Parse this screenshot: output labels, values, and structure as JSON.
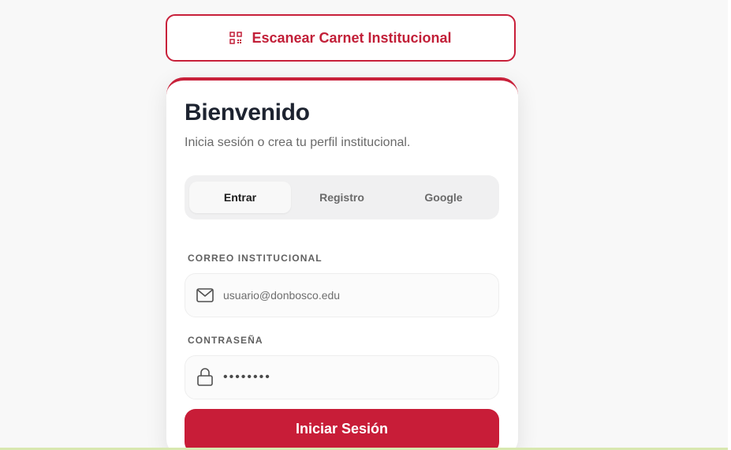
{
  "scan_button": {
    "label": "Escanear Carnet Institucional",
    "icon": "qr-code-icon"
  },
  "card": {
    "title": "Bienvenido",
    "subtitle": "Inicia sesión o crea tu perfil institucional."
  },
  "tabs": [
    {
      "label": "Entrar",
      "active": true
    },
    {
      "label": "Registro",
      "active": false
    },
    {
      "label": "Google",
      "active": false
    }
  ],
  "email": {
    "label": "CORREO INSTITUCIONAL",
    "placeholder": "usuario@donbosco.edu",
    "value": "",
    "icon": "mail-icon"
  },
  "password": {
    "label": "CONTRASEÑA",
    "value": "••••••••",
    "icon": "lock-icon"
  },
  "submit": {
    "label": "Iniciar Sesión"
  },
  "colors": {
    "accent": "#c81d38",
    "background": "#f8f8f8",
    "title": "#1d2330"
  }
}
